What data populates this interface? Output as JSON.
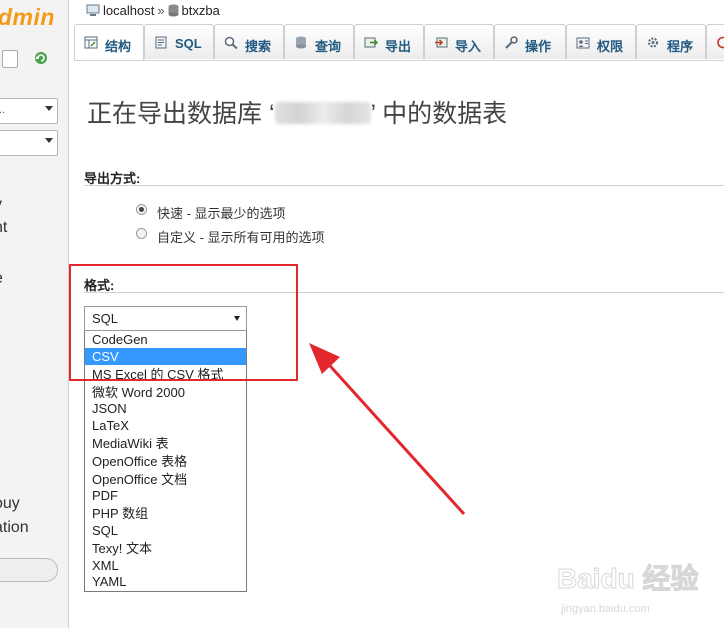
{
  "sidebar": {
    "logo": "dmin",
    "select1_value": "..",
    "select2_value": "",
    "texts": [
      "y",
      "nt",
      "e",
      "r",
      "ouy",
      "ation"
    ]
  },
  "breadcrumb": {
    "server": "localhost",
    "separator": "»",
    "database": "btxzba"
  },
  "tabs": [
    {
      "label": "结构",
      "icon": "structure-icon"
    },
    {
      "label": "SQL",
      "icon": "sql-icon"
    },
    {
      "label": "搜索",
      "icon": "search-icon"
    },
    {
      "label": "查询",
      "icon": "query-icon"
    },
    {
      "label": "导出",
      "icon": "export-icon"
    },
    {
      "label": "导入",
      "icon": "import-icon"
    },
    {
      "label": "操作",
      "icon": "wrench-icon"
    },
    {
      "label": "权限",
      "icon": "privileges-icon"
    },
    {
      "label": "程序",
      "icon": "routines-icon"
    }
  ],
  "page": {
    "title_prefix": "正在导出数据库 ‘",
    "title_suffix": "’ 中的数据表",
    "export_method_label": "导出方式:",
    "method_options": [
      {
        "label": "快速 - 显示最少的选项",
        "checked": true
      },
      {
        "label": "自定义 - 显示所有可用的选项",
        "checked": false
      }
    ],
    "format_label": "格式:",
    "format_selected": "SQL",
    "format_options": [
      "CodeGen",
      "CSV",
      "MS Excel 的 CSV 格式",
      "微软 Word 2000",
      "JSON",
      "LaTeX",
      "MediaWiki 表",
      "OpenOffice 表格",
      "OpenOffice 文档",
      "PDF",
      "PHP 数组",
      "SQL",
      "Texy! 文本",
      "XML",
      "YAML"
    ],
    "highlighted_option": "CSV"
  },
  "watermark": {
    "text": "Baidu 经验",
    "url_text": "jingyan.baidu.com"
  },
  "colors": {
    "accent": "#235a81",
    "highlight": "#3399ff",
    "annotation": "#e2272d",
    "logo": "#f49a16"
  }
}
